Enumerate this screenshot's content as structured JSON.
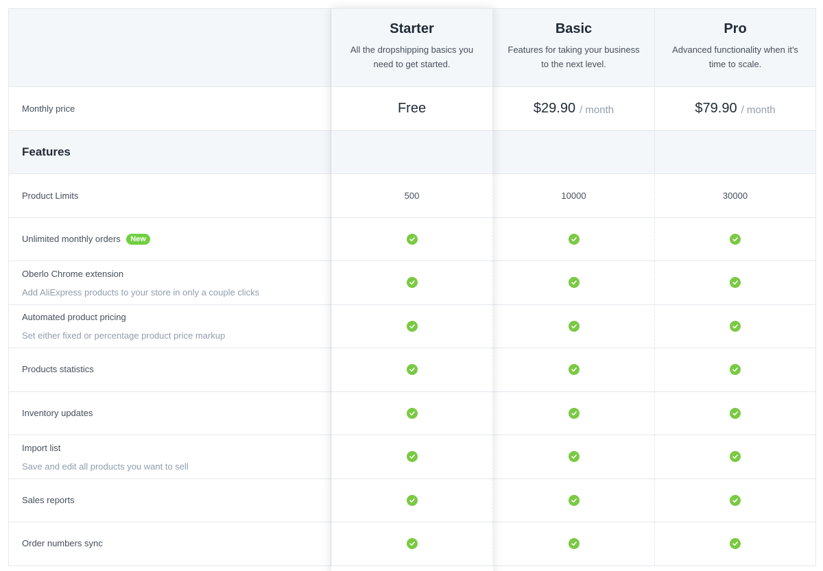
{
  "plans": [
    {
      "name": "Starter",
      "description": "All the dropshipping basics you need to get started.",
      "price": "Free",
      "unit": ""
    },
    {
      "name": "Basic",
      "description": "Features for taking your business to the next level.",
      "price": "$29.90",
      "unit": "/ month"
    },
    {
      "name": "Pro",
      "description": "Advanced functionality when it's time to scale.",
      "price": "$79.90",
      "unit": "/ month"
    }
  ],
  "price_row_label": "Monthly price",
  "section_title": "Features",
  "product_limits": {
    "label": "Product Limits",
    "values": [
      "500",
      "10000",
      "30000"
    ]
  },
  "features": [
    {
      "label": "Unlimited monthly orders",
      "badge": "New",
      "sub": ""
    },
    {
      "label": "Oberlo Chrome extension",
      "badge": "",
      "sub": "Add AliExpress products to your store in only a couple clicks"
    },
    {
      "label": "Automated product pricing",
      "badge": "",
      "sub": "Set either fixed or percentage product price markup"
    },
    {
      "label": "Products statistics",
      "badge": "",
      "sub": ""
    },
    {
      "label": "Inventory updates",
      "badge": "",
      "sub": ""
    },
    {
      "label": "Import list",
      "badge": "",
      "sub": "Save and edit all products you want to sell"
    },
    {
      "label": "Sales reports",
      "badge": "",
      "sub": ""
    },
    {
      "label": "Order numbers sync",
      "badge": "",
      "sub": ""
    }
  ],
  "colors": {
    "check": "#7ac943",
    "badge": "#6fcf3f",
    "header_bg": "#f4f7fa"
  }
}
